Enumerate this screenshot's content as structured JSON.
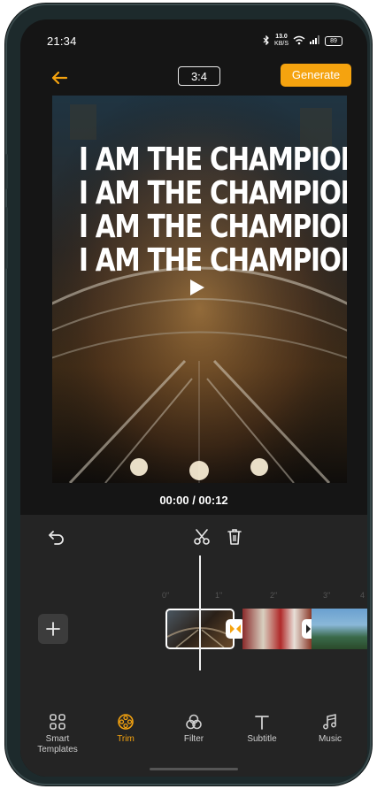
{
  "status_bar": {
    "time": "21:34",
    "network_speed": "13.0",
    "network_unit": "KB/S",
    "battery": "89"
  },
  "toolbar": {
    "aspect_ratio": "3:4",
    "generate_label": "Generate"
  },
  "preview": {
    "overlay_lines": [
      "I AM THE CHAMPION",
      "I AM THE CHAMPION",
      "I AM THE CHAMPION",
      "I AM THE CHAMPION"
    ]
  },
  "player": {
    "timecode": "00:00 / 00:12"
  },
  "timeline": {
    "ticks": [
      "0\"",
      "1\"",
      "2\"",
      "3\"",
      "4"
    ]
  },
  "bottom_nav": {
    "items": [
      {
        "label_line1": "Smart",
        "label_line2": "Templates",
        "icon": "grid-icon",
        "active": false
      },
      {
        "label_line1": "Trim",
        "label_line2": "",
        "icon": "film-reel-icon",
        "active": true
      },
      {
        "label_line1": "Filter",
        "label_line2": "",
        "icon": "filter-circles-icon",
        "active": false
      },
      {
        "label_line1": "Subtitle",
        "label_line2": "",
        "icon": "text-t-icon",
        "active": false
      },
      {
        "label_line1": "Music",
        "label_line2": "",
        "icon": "music-note-icon",
        "active": false
      }
    ]
  },
  "colors": {
    "accent": "#f5a30f",
    "background": "#151515",
    "panel": "#242424"
  }
}
